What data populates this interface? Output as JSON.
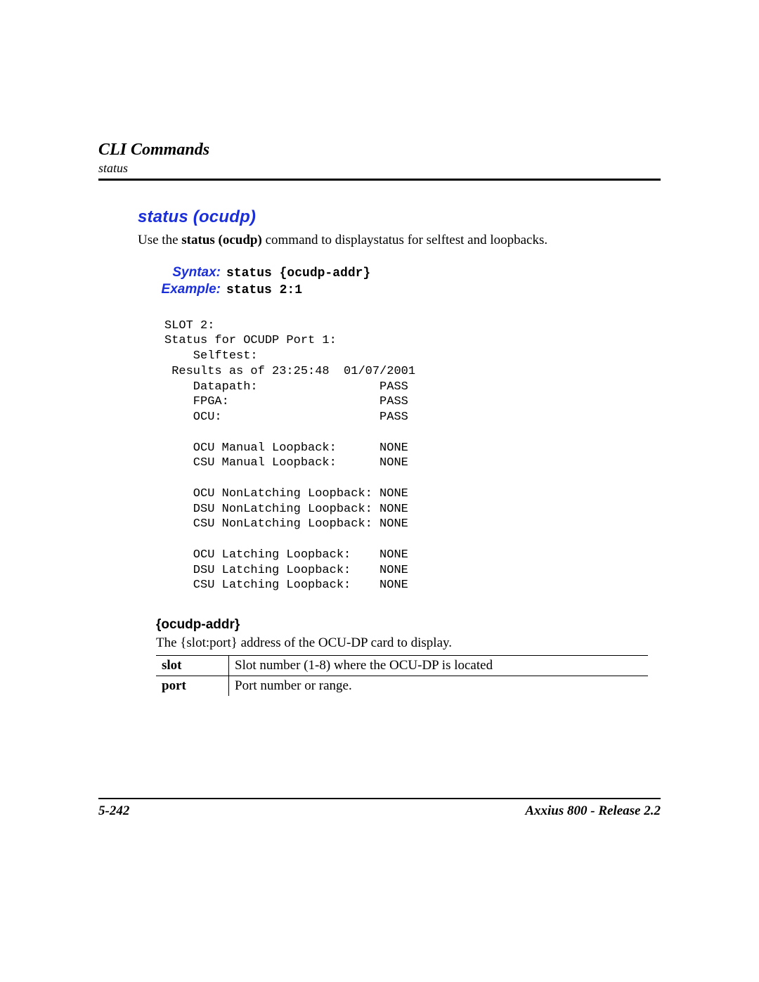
{
  "header": {
    "chapter": "CLI Commands",
    "sub": "status"
  },
  "section": {
    "title": "status (ocudp)",
    "intro_prefix": "Use the ",
    "intro_bold": "status (ocudp)",
    "intro_suffix": " command to displaystatus for selftest and loopbacks."
  },
  "syntax": {
    "label": "Syntax:",
    "code": "status {ocudp-addr}"
  },
  "example": {
    "label": "Example:",
    "code": "status 2:1"
  },
  "output": "SLOT 2:\nStatus for OCUDP Port 1:\n    Selftest:\n Results as of 23:25:48  01/07/2001\n    Datapath:                 PASS\n    FPGA:                     PASS\n    OCU:                      PASS\n\n    OCU Manual Loopback:      NONE\n    CSU Manual Loopback:      NONE\n\n    OCU NonLatching Loopback: NONE\n    DSU NonLatching Loopback: NONE\n    CSU NonLatching Loopback: NONE\n\n    OCU Latching Loopback:    NONE\n    DSU Latching Loopback:    NONE\n    CSU Latching Loopback:    NONE",
  "param": {
    "heading": "{ocudp-addr}",
    "desc": "The {slot:port} address of the OCU-DP card to display.",
    "rows": [
      {
        "key": "slot",
        "val": "Slot number (1-8) where the OCU-DP is located"
      },
      {
        "key": "port",
        "val": "Port number or range."
      }
    ]
  },
  "footer": {
    "page": "5-242",
    "product": "Axxius 800 - Release 2.2"
  }
}
